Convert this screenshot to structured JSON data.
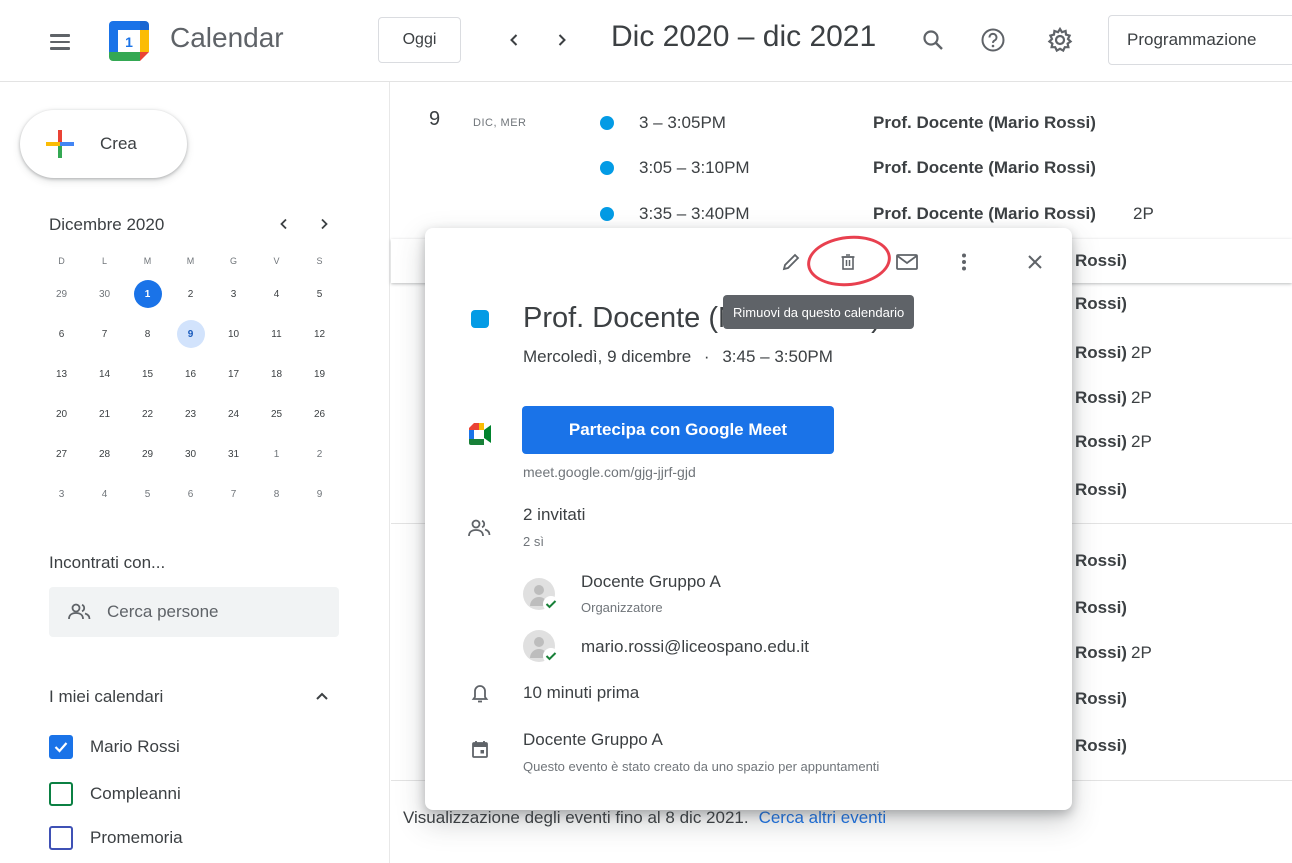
{
  "header": {
    "app_title": "Calendar",
    "logo_day": "1",
    "today_button": "Oggi",
    "date_range": "Dic 2020 – dic 2021",
    "view_button": "Programmazione"
  },
  "sidebar": {
    "create_label": "Crea",
    "mini_calendar": {
      "title": "Dicembre 2020",
      "weekdays": [
        "D",
        "L",
        "M",
        "M",
        "G",
        "V",
        "S"
      ],
      "weeks": [
        [
          "29",
          "30",
          "1",
          "2",
          "3",
          "4",
          "5"
        ],
        [
          "6",
          "7",
          "8",
          "9",
          "10",
          "11",
          "12"
        ],
        [
          "13",
          "14",
          "15",
          "16",
          "17",
          "18",
          "19"
        ],
        [
          "20",
          "21",
          "22",
          "23",
          "24",
          "25",
          "26"
        ],
        [
          "27",
          "28",
          "29",
          "30",
          "31",
          "1",
          "2"
        ],
        [
          "3",
          "4",
          "5",
          "6",
          "7",
          "8",
          "9"
        ]
      ],
      "today": "1",
      "selected": "9"
    },
    "meet_with_label": "Incontrati con...",
    "search_people_placeholder": "Cerca persone",
    "my_calendars_label": "I miei calendari",
    "calendars": [
      {
        "name": "Mario Rossi",
        "checked": true,
        "color": "#1a73e8"
      },
      {
        "name": "Compleanni",
        "checked": false,
        "color": "#0b8043"
      },
      {
        "name": "Promemoria",
        "checked": false,
        "color": "#3f51b5"
      }
    ]
  },
  "agenda": {
    "day_number": "9",
    "day_label": "DIC, MER",
    "events": [
      {
        "time": "3 – 3:05PM",
        "title": "Prof. Docente (Mario Rossi)",
        "extra": ""
      },
      {
        "time": "3:05 – 3:10PM",
        "title": "Prof. Docente (Mario Rossi)",
        "extra": ""
      },
      {
        "time": "3:35 – 3:40PM",
        "title": "Prof. Docente (Mario Rossi)",
        "extra": "2P"
      }
    ],
    "partial_rows": [
      {
        "text": "Rossi)",
        "extra": ""
      },
      {
        "text": "Rossi)",
        "extra": ""
      },
      {
        "text": "Rossi)",
        "extra": "2P"
      },
      {
        "text": "Rossi)",
        "extra": "2P"
      },
      {
        "text": "Rossi)",
        "extra": "2P"
      },
      {
        "text": "Rossi)",
        "extra": ""
      },
      {
        "text": "Rossi)",
        "extra": ""
      },
      {
        "text": "Rossi)",
        "extra": ""
      },
      {
        "text": "Rossi)",
        "extra": "2P"
      },
      {
        "text": "Rossi)",
        "extra": ""
      },
      {
        "text": "Rossi)",
        "extra": ""
      }
    ],
    "footer_text": "Visualizzazione degli eventi fino al 8 dic 2021.",
    "footer_link": "Cerca altri eventi"
  },
  "popup": {
    "tooltip": "Rimuovi da questo calendario",
    "title": "Prof. Docente (Mario Rossi)",
    "date": "Mercoledì, 9 dicembre",
    "separator": "·",
    "time": "3:45 – 3:50PM",
    "meet_button": "Partecipa con Google Meet",
    "meet_link": "meet.google.com/gjg-jjrf-gjd",
    "guests_count": "2 invitati",
    "guests_yes": "2 sì",
    "guests": [
      {
        "name": "Docente Gruppo A",
        "role": "Organizzatore"
      },
      {
        "name": "mario.rossi@liceospano.edu.it",
        "role": ""
      }
    ],
    "reminder": "10 minuti prima",
    "calendar_name": "Docente Gruppo A",
    "calendar_note": "Questo evento è stato creato da uno spazio per appuntamenti",
    "colors": {
      "event": "#039be5",
      "meet_button": "#1a73e8",
      "highlight": "#e8404f"
    }
  }
}
